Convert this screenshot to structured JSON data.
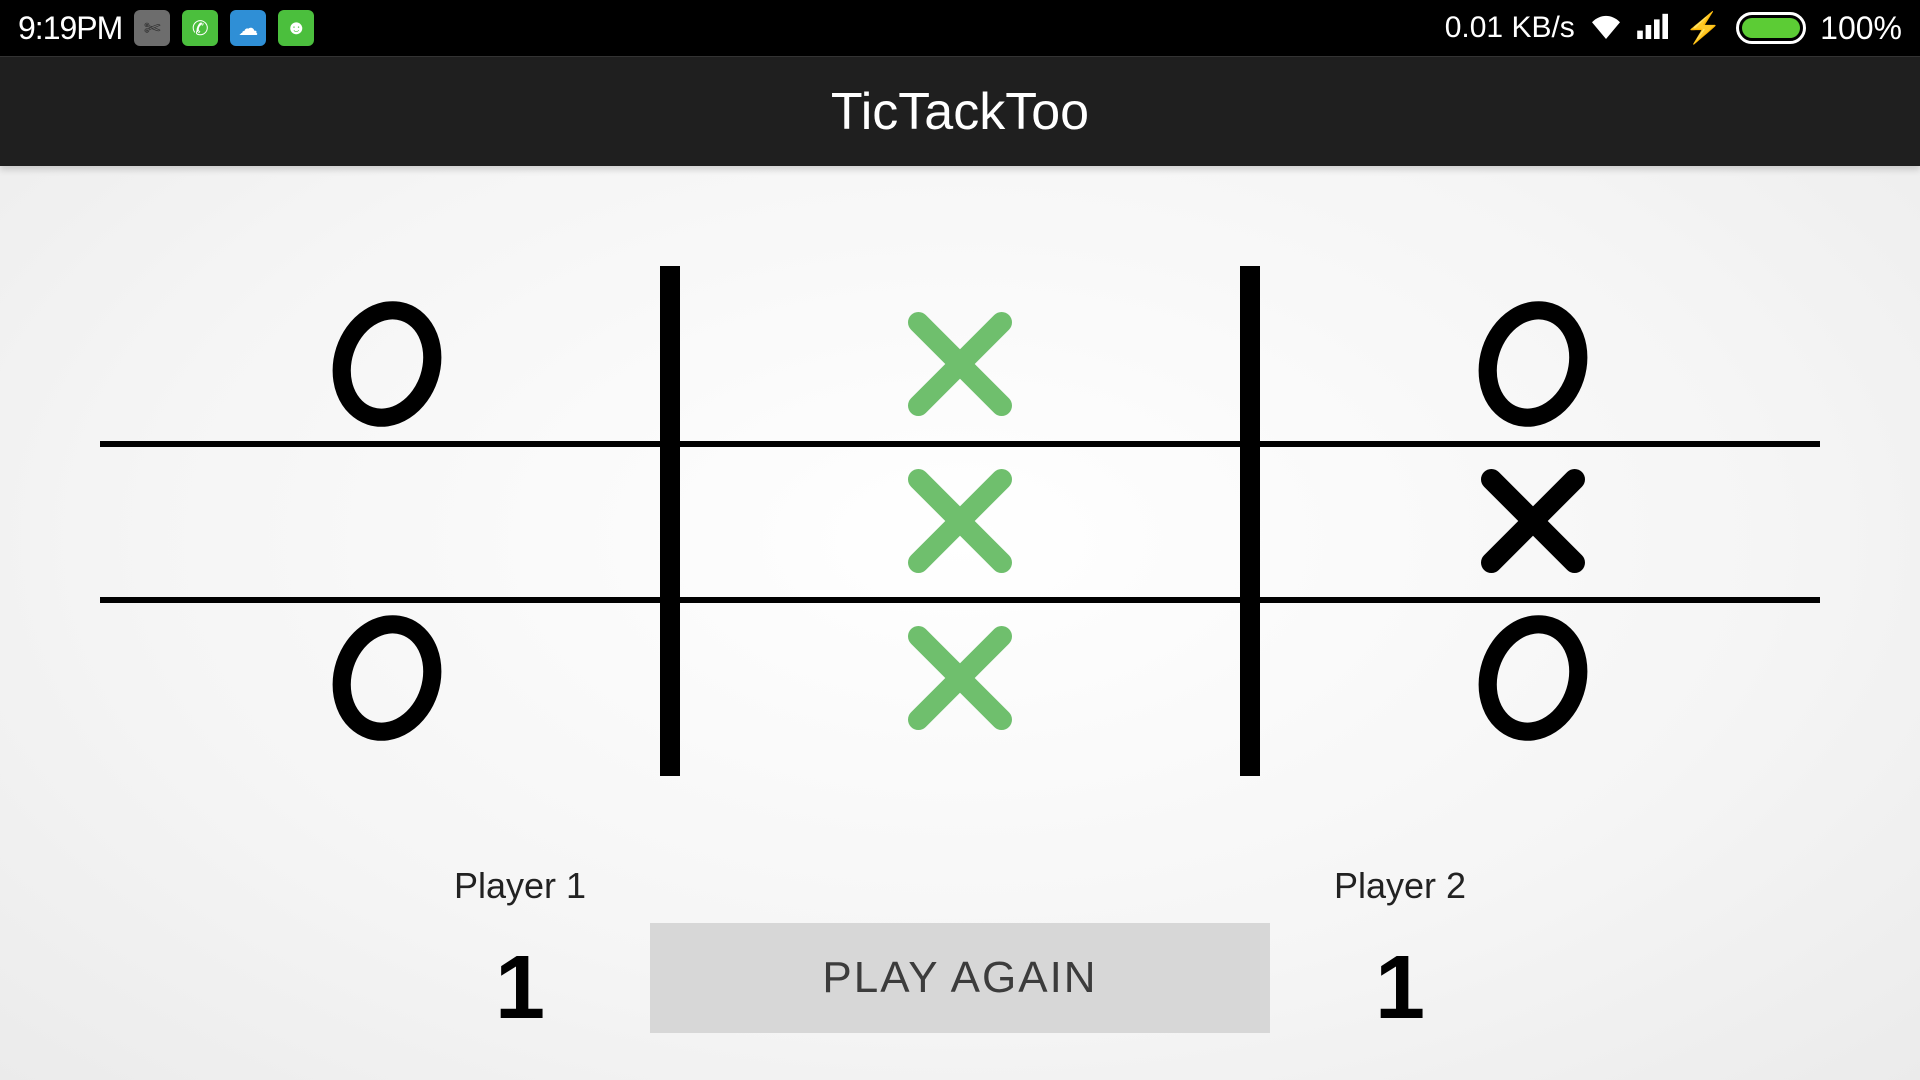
{
  "statusbar": {
    "time": "9:19PM",
    "data_rate": "0.01 KB/s",
    "battery_pct": "100%",
    "tray_icons": [
      "scissors-icon",
      "phone-icon",
      "cloud-icon",
      "robot-icon"
    ]
  },
  "titlebar": {
    "title": "TicTackToo"
  },
  "board": {
    "cells": [
      [
        "O",
        "X",
        "O"
      ],
      [
        "",
        "X",
        "X"
      ],
      [
        "O",
        "X",
        "O"
      ]
    ],
    "winning_line": "col-1"
  },
  "footer": {
    "player1_label": "Player 1",
    "player1_score": "1",
    "player2_label": "Player 2",
    "player2_score": "1",
    "play_again_label": "PLAY AGAIN"
  }
}
